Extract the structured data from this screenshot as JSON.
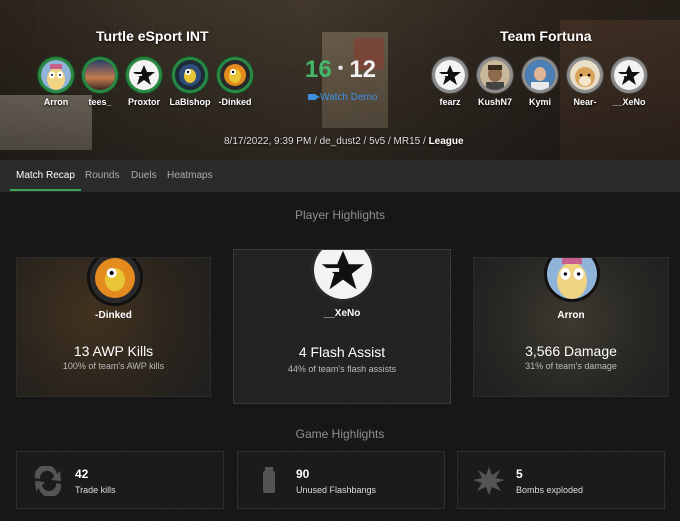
{
  "header": {
    "team1": {
      "name": "Turtle eSport INT",
      "score": "16",
      "players": [
        {
          "name": "Arron",
          "avatar": "cartoon-face-avatar"
        },
        {
          "name": "tees_",
          "avatar": "sunset-avatar"
        },
        {
          "name": "Proxtor",
          "avatar": "star-logo-avatar"
        },
        {
          "name": "LaBishop",
          "avatar": "turtle-avatar"
        },
        {
          "name": "-Dinked",
          "avatar": "turtle-avatar"
        }
      ]
    },
    "team2": {
      "name": "Team Fortuna",
      "score": "12",
      "players": [
        {
          "name": "fearz",
          "avatar": "star-logo-avatar"
        },
        {
          "name": "KushN7",
          "avatar": "photo-avatar"
        },
        {
          "name": "Kymi",
          "avatar": "photo-avatar"
        },
        {
          "name": "Near-",
          "avatar": "doge-avatar"
        },
        {
          "name": "__XeNo",
          "avatar": "star-logo-avatar"
        }
      ]
    },
    "score_separator": "•",
    "watch_demo": "Watch Demo",
    "meta_prefix": "8/17/2022, 9:39 PM / de_dust2 / 5v5 / MR15 / ",
    "meta_type": "League"
  },
  "tabs": [
    {
      "label": "Match Recap",
      "active": true
    },
    {
      "label": "Rounds",
      "active": false
    },
    {
      "label": "Duels",
      "active": false
    },
    {
      "label": "Heatmaps",
      "active": false
    }
  ],
  "player_highlights": {
    "title": "Player Highlights",
    "cards": [
      {
        "player": "-Dinked",
        "value": "13 AWP Kills",
        "sub": "100% of team's AWP kills",
        "avatar": "turtle-avatar"
      },
      {
        "player": "__XeNo",
        "value": "4 Flash Assist",
        "sub": "44% of team's flash assists",
        "avatar": "star-logo-avatar"
      },
      {
        "player": "Arron",
        "value": "3,566 Damage",
        "sub": "31% of team's damage",
        "avatar": "cartoon-face-avatar"
      }
    ]
  },
  "game_highlights": {
    "title": "Game Highlights",
    "cards": [
      {
        "value": "42",
        "label": "Trade kills",
        "icon": "trade-arrows-icon"
      },
      {
        "value": "90",
        "label": "Unused Flashbangs",
        "icon": "flashbang-icon"
      },
      {
        "value": "5",
        "label": "Bombs exploded",
        "icon": "explosion-icon"
      }
    ]
  },
  "colors": {
    "accent_green": "#3aa655",
    "team1_score": "#44b868",
    "link_blue": "#3d8fe0"
  }
}
